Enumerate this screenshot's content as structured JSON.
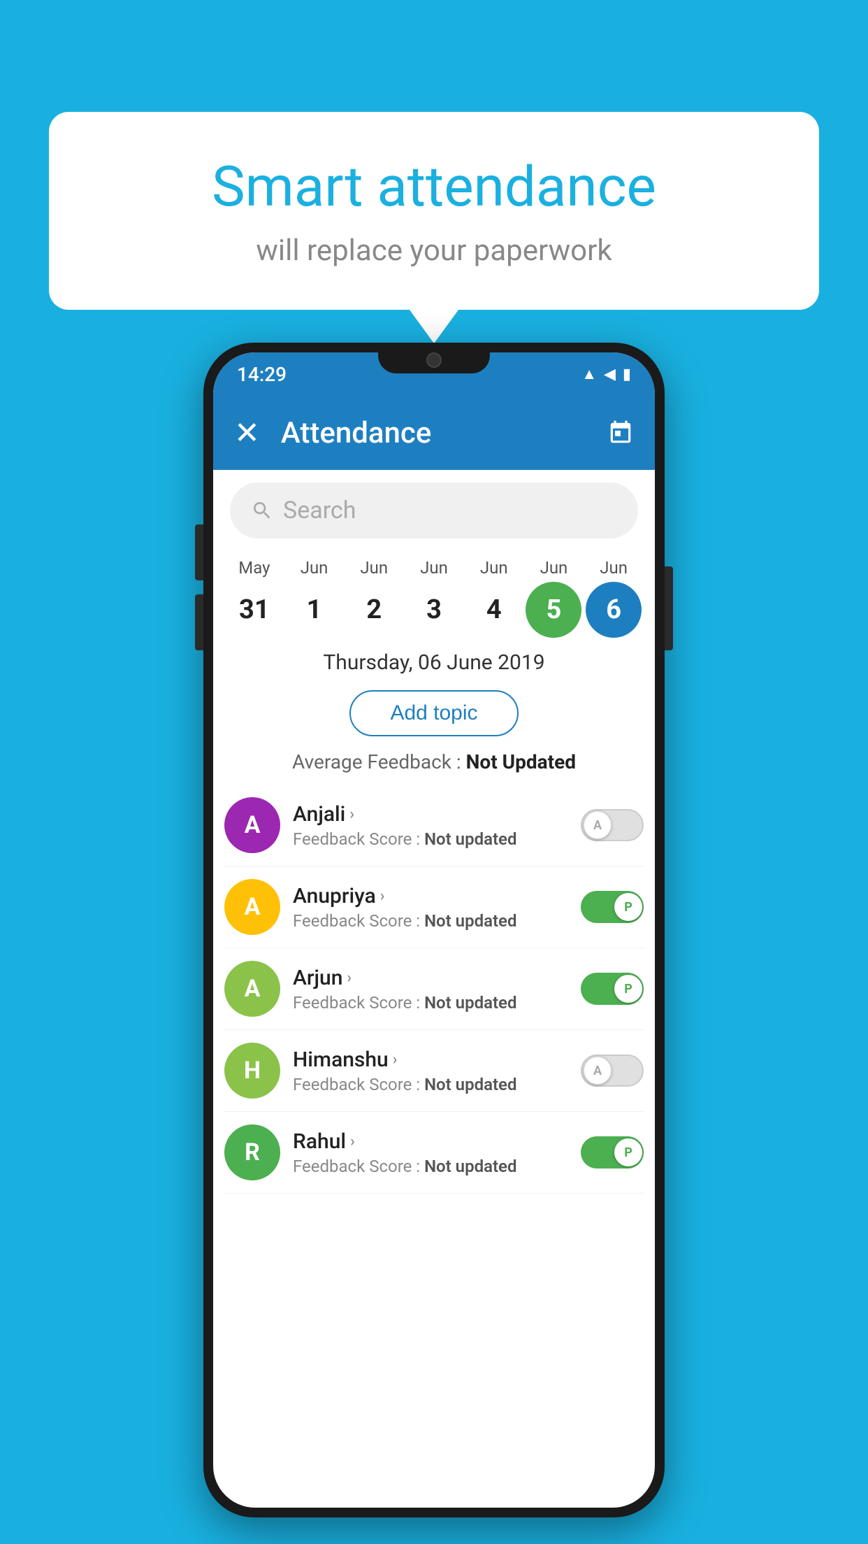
{
  "background_color": "#19b0e0",
  "bubble": {
    "title": "Smart attendance",
    "subtitle": "will replace your paperwork"
  },
  "status_bar": {
    "time": "14:29"
  },
  "app_bar": {
    "title": "Attendance",
    "close_label": "×",
    "calendar_label": "📅"
  },
  "search": {
    "placeholder": "Search"
  },
  "calendar": {
    "days": [
      {
        "month": "May",
        "date": "31",
        "state": "normal"
      },
      {
        "month": "Jun",
        "date": "1",
        "state": "normal"
      },
      {
        "month": "Jun",
        "date": "2",
        "state": "normal"
      },
      {
        "month": "Jun",
        "date": "3",
        "state": "normal"
      },
      {
        "month": "Jun",
        "date": "4",
        "state": "normal"
      },
      {
        "month": "Jun",
        "date": "5",
        "state": "today"
      },
      {
        "month": "Jun",
        "date": "6",
        "state": "selected"
      }
    ],
    "selected_date": "Thursday, 06 June 2019"
  },
  "add_topic_label": "Add topic",
  "avg_feedback": {
    "label": "Average Feedback :",
    "value": "Not Updated"
  },
  "students": [
    {
      "name": "Anjali",
      "initial": "A",
      "avatar_color": "#9c27b0",
      "feedback_label": "Feedback Score :",
      "feedback_value": "Not updated",
      "toggle": "off",
      "toggle_letter": "A"
    },
    {
      "name": "Anupriya",
      "initial": "A",
      "avatar_color": "#ffc107",
      "feedback_label": "Feedback Score :",
      "feedback_value": "Not updated",
      "toggle": "on",
      "toggle_letter": "P"
    },
    {
      "name": "Arjun",
      "initial": "A",
      "avatar_color": "#8bc34a",
      "feedback_label": "Feedback Score :",
      "feedback_value": "Not updated",
      "toggle": "on",
      "toggle_letter": "P"
    },
    {
      "name": "Himanshu",
      "initial": "H",
      "avatar_color": "#8bc34a",
      "feedback_label": "Feedback Score :",
      "feedback_value": "Not updated",
      "toggle": "off",
      "toggle_letter": "A"
    },
    {
      "name": "Rahul",
      "initial": "R",
      "avatar_color": "#4caf50",
      "feedback_label": "Feedback Score :",
      "feedback_value": "Not updated",
      "toggle": "on",
      "toggle_letter": "P"
    }
  ]
}
